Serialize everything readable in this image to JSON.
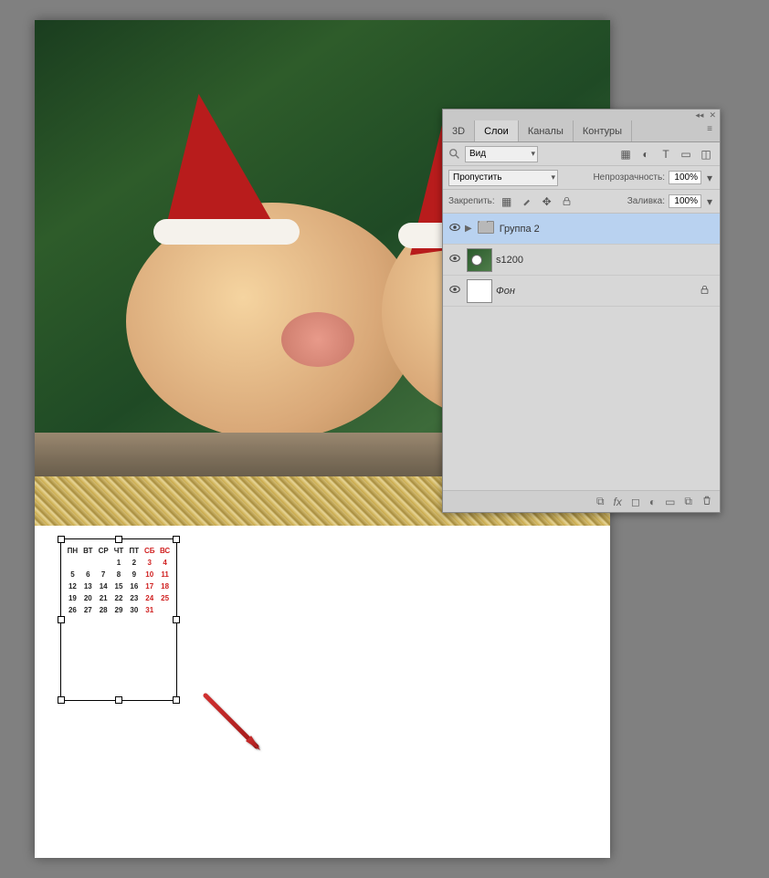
{
  "panel": {
    "tabs": [
      "3D",
      "Слои",
      "Каналы",
      "Контуры"
    ],
    "activeTabIndex": 1,
    "search": {
      "placeholder": "Вид"
    },
    "blendMode": "Пропустить",
    "opacityLabel": "Непрозрачность:",
    "opacityValue": "100%",
    "lockLabel": "Закрепить:",
    "fillLabel": "Заливка:",
    "fillValue": "100%",
    "layers": [
      {
        "name": "Группа 2",
        "type": "group",
        "visible": true,
        "selected": true,
        "italic": false,
        "locked": false
      },
      {
        "name": "s1200",
        "type": "smartobject",
        "visible": true,
        "selected": false,
        "italic": false,
        "locked": false
      },
      {
        "name": "Фон",
        "type": "background",
        "visible": true,
        "selected": false,
        "italic": true,
        "locked": true
      }
    ]
  },
  "calendar": {
    "headers": [
      "ПН",
      "ВТ",
      "СР",
      "ЧТ",
      "ПТ",
      "СБ",
      "ВС"
    ],
    "rows": [
      [
        "",
        "",
        "",
        "1",
        "2",
        "3",
        "4"
      ],
      [
        "5",
        "6",
        "7",
        "8",
        "9",
        "10",
        "11"
      ],
      [
        "12",
        "13",
        "14",
        "15",
        "16",
        "17",
        "18"
      ],
      [
        "19",
        "20",
        "21",
        "22",
        "23",
        "24",
        "25"
      ],
      [
        "26",
        "27",
        "28",
        "29",
        "30",
        "31",
        ""
      ]
    ],
    "weekendCols": [
      5,
      6
    ]
  }
}
